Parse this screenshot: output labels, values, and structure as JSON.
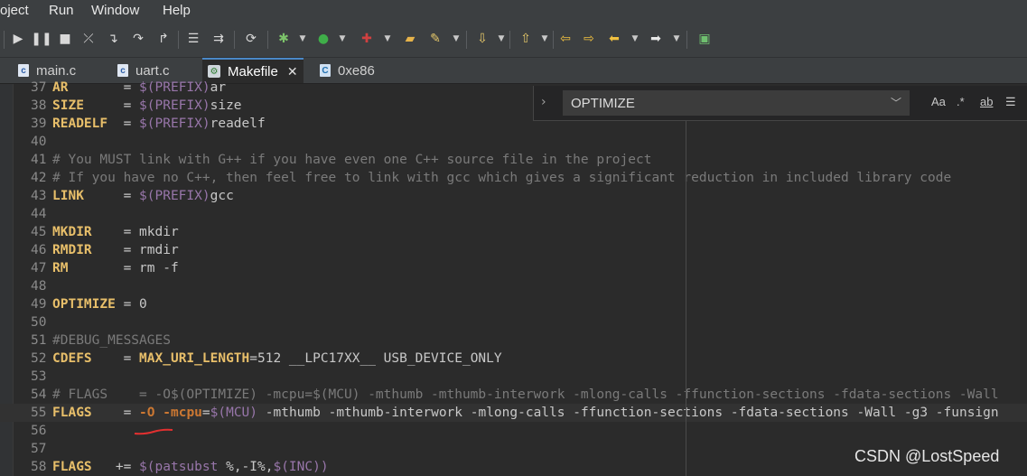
{
  "menu": {
    "items": [
      "oject",
      "Run",
      "Window",
      "Help"
    ]
  },
  "toolbar": {
    "icons": [
      "resume-icon",
      "suspend-icon",
      "terminate-icon",
      "disconnect-icon",
      "step-into-icon",
      "step-over-icon",
      "step-return-icon",
      "toggle-icon",
      "instruction-step-icon",
      "refresh-icon",
      "debug-icon",
      "run-icon",
      "external-tools-icon",
      "open-folder-icon",
      "brush-icon",
      "annotation-icon",
      "up-icon",
      "back-edit-icon",
      "forward-edit-icon",
      "back-icon",
      "forward-icon",
      "pin-icon"
    ]
  },
  "tabs": [
    {
      "label": "main.c",
      "active": false
    },
    {
      "label": "uart.c",
      "active": false
    },
    {
      "label": "Makefile",
      "active": true
    },
    {
      "label": "0xe86",
      "active": false
    }
  ],
  "find": {
    "value": "OPTIMIZE",
    "options": [
      "Aa",
      ".*",
      "ab"
    ]
  },
  "code_lines": [
    {
      "n": "37",
      "tokens": [
        {
          "t": "AR",
          "c": "kw"
        },
        {
          "t": "       = ",
          "c": "plain"
        },
        {
          "t": "$(PREFIX)",
          "c": "var"
        },
        {
          "t": "ar",
          "c": "plain"
        }
      ]
    },
    {
      "n": "38",
      "tokens": [
        {
          "t": "SIZE",
          "c": "kw"
        },
        {
          "t": "     = ",
          "c": "plain"
        },
        {
          "t": "$(PREFIX)",
          "c": "var"
        },
        {
          "t": "size",
          "c": "plain"
        }
      ]
    },
    {
      "n": "39",
      "tokens": [
        {
          "t": "READELF",
          "c": "kw"
        },
        {
          "t": "  = ",
          "c": "plain"
        },
        {
          "t": "$(PREFIX)",
          "c": "var"
        },
        {
          "t": "readelf",
          "c": "plain"
        }
      ]
    },
    {
      "n": "40",
      "tokens": []
    },
    {
      "n": "41",
      "tokens": [
        {
          "t": "# You MUST link with G++ if you have even one C++ source file in the project",
          "c": "cm"
        }
      ]
    },
    {
      "n": "42",
      "tokens": [
        {
          "t": "# If you have no C++, then feel free to link with gcc which gives a significant reduction in included library code",
          "c": "cm"
        }
      ]
    },
    {
      "n": "43",
      "tokens": [
        {
          "t": "LINK",
          "c": "kw"
        },
        {
          "t": "     = ",
          "c": "plain"
        },
        {
          "t": "$(PREFIX)",
          "c": "var"
        },
        {
          "t": "gcc",
          "c": "plain"
        }
      ]
    },
    {
      "n": "44",
      "tokens": []
    },
    {
      "n": "45",
      "tokens": [
        {
          "t": "MKDIR",
          "c": "kw"
        },
        {
          "t": "    = mkdir",
          "c": "plain"
        }
      ]
    },
    {
      "n": "46",
      "tokens": [
        {
          "t": "RMDIR",
          "c": "kw"
        },
        {
          "t": "    = rmdir",
          "c": "plain"
        }
      ]
    },
    {
      "n": "47",
      "tokens": [
        {
          "t": "RM",
          "c": "kw"
        },
        {
          "t": "       = rm -f",
          "c": "plain"
        }
      ]
    },
    {
      "n": "48",
      "tokens": []
    },
    {
      "n": "49",
      "tokens": [
        {
          "t": "OPTIMIZE",
          "c": "kw"
        },
        {
          "t": " = 0",
          "c": "plain"
        }
      ]
    },
    {
      "n": "50",
      "tokens": []
    },
    {
      "n": "51",
      "tokens": [
        {
          "t": "#DEBUG_MESSAGES",
          "c": "cm"
        }
      ]
    },
    {
      "n": "52",
      "tokens": [
        {
          "t": "CDEFS",
          "c": "kw"
        },
        {
          "t": "    = ",
          "c": "plain"
        },
        {
          "t": "MAX_URI_LENGTH",
          "c": "kw"
        },
        {
          "t": "=512 __LPC17XX__ USB_DEVICE_ONLY",
          "c": "plain"
        }
      ]
    },
    {
      "n": "53",
      "tokens": []
    },
    {
      "n": "54",
      "tokens": [
        {
          "t": "# FLAGS    = -O$(OPTIMIZE) -mcpu=$(MCU) -mthumb -mthumb-interwork -mlong-calls -ffunction-sections -fdata-sections -Wall",
          "c": "cm"
        }
      ]
    },
    {
      "n": "55",
      "current": true,
      "tokens": [
        {
          "t": "FLAGS",
          "c": "kw"
        },
        {
          "t": "    = ",
          "c": "plain"
        },
        {
          "t": "-O",
          "c": "flag"
        },
        {
          "t": " ",
          "c": "plain"
        },
        {
          "t": "-mcpu",
          "c": "flag"
        },
        {
          "t": "=",
          "c": "plain"
        },
        {
          "t": "$(MCU)",
          "c": "var"
        },
        {
          "t": " -mthumb -mthumb-interwork -mlong-calls -ffunction-sections -fdata-sections -Wall -g3 -funsign",
          "c": "plain"
        }
      ]
    },
    {
      "n": "56",
      "tokens": []
    },
    {
      "n": "57",
      "tokens": []
    },
    {
      "n": "58",
      "tokens": [
        {
          "t": "FLAGS",
          "c": "kw"
        },
        {
          "t": "   += ",
          "c": "plain"
        },
        {
          "t": "$(patsubst",
          "c": "var"
        },
        {
          "t": " %,-I%,",
          "c": "plain"
        },
        {
          "t": "$(INC))",
          "c": "var"
        }
      ]
    }
  ],
  "watermark": "CSDN @LostSpeed"
}
